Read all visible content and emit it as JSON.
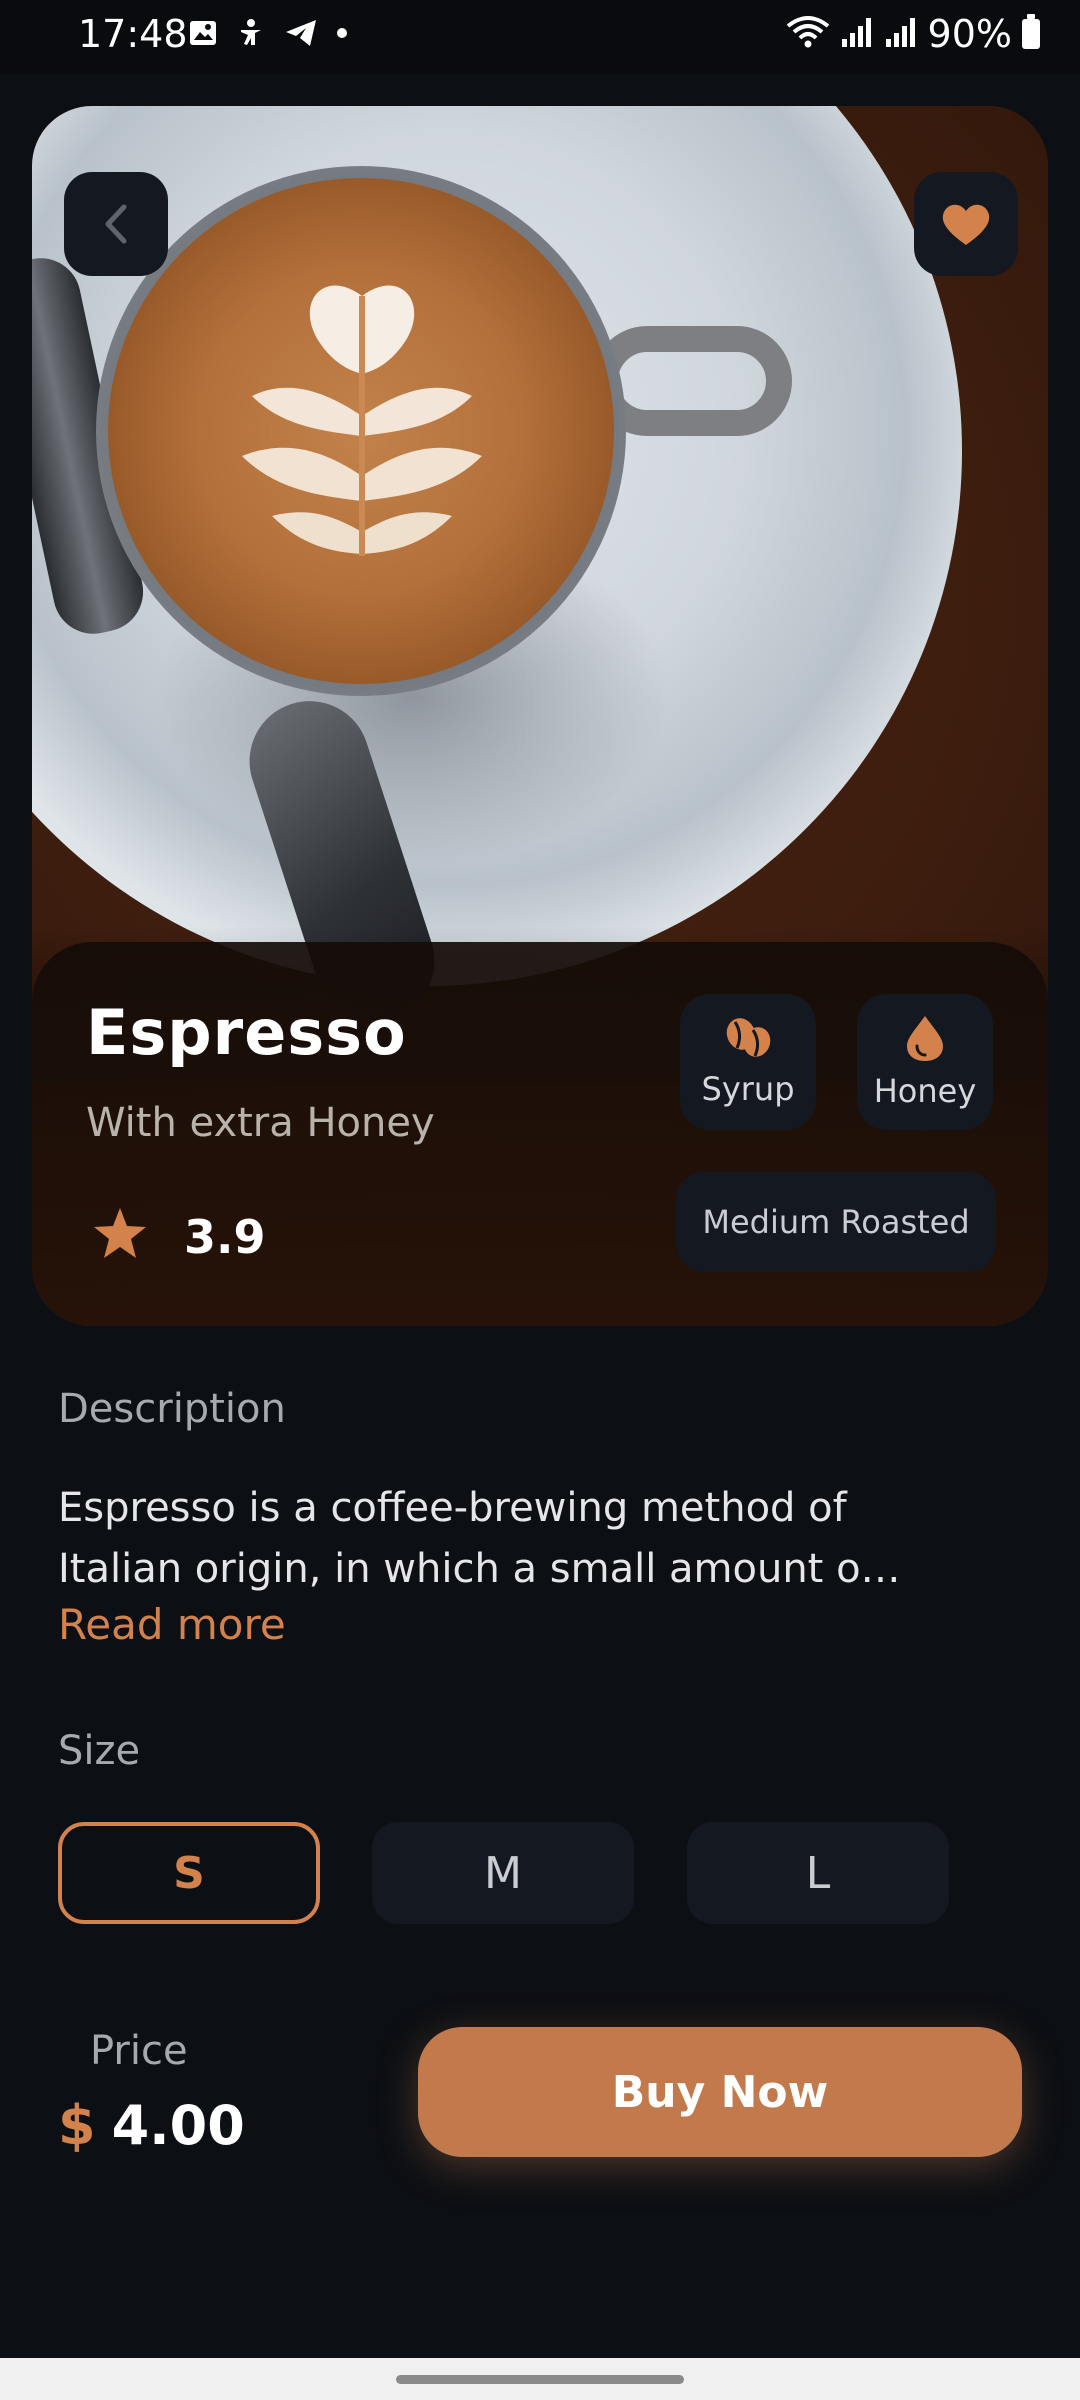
{
  "status_bar": {
    "time": "17:48",
    "battery": "90%",
    "left_icons": [
      "image-icon",
      "accessibility-icon",
      "telegram-icon",
      "dot-icon"
    ],
    "right_icons": [
      "wifi-icon",
      "signal-icon",
      "signal-icon",
      "battery-icon"
    ]
  },
  "product": {
    "name": "Espresso",
    "subtitle": "With extra Honey",
    "rating": "3.9",
    "ingredients": [
      {
        "label": "Syrup",
        "icon": "coffee-beans-icon"
      },
      {
        "label": "Honey",
        "icon": "drop-icon"
      }
    ],
    "roast": "Medium Roasted"
  },
  "description": {
    "heading": "Description",
    "line1": "Espresso is a coffee-brewing method of",
    "line2": "Italian origin, in which a small amount o…",
    "read_more": "Read more"
  },
  "size": {
    "heading": "Size",
    "options": [
      "S",
      "M",
      "L"
    ],
    "selected": "S"
  },
  "price": {
    "label": "Price",
    "currency": "$",
    "value": "4.00"
  },
  "actions": {
    "buy_label": "Buy Now"
  },
  "colors": {
    "accent": "#d2824a",
    "button": "#c27a4d",
    "background": "#0c0f14",
    "surface": "#141821"
  }
}
